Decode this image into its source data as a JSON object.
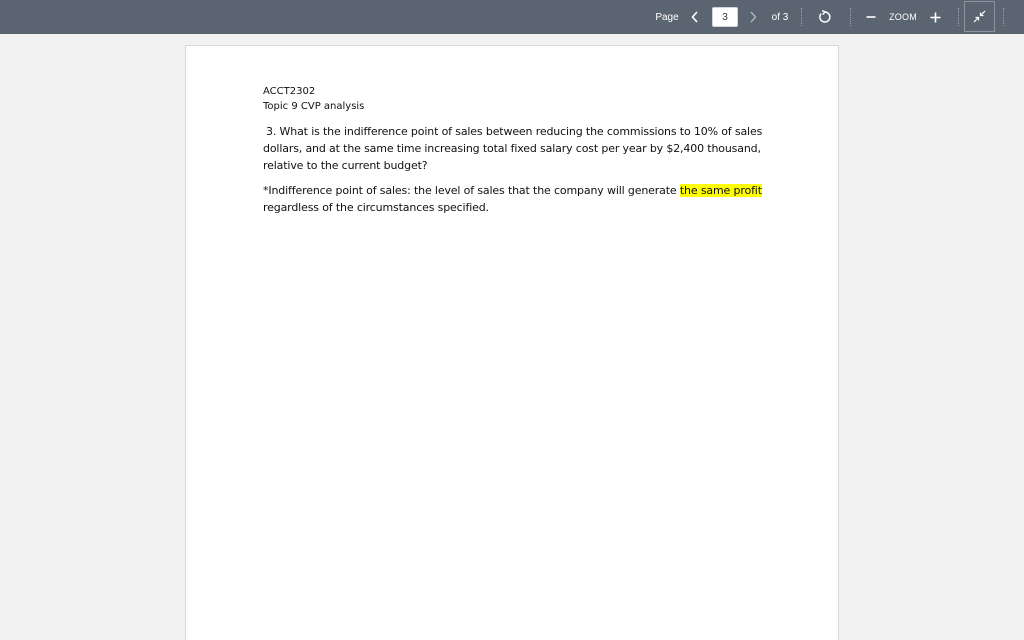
{
  "toolbar": {
    "page_label": "Page",
    "current_page": "3",
    "of_label": "of 3",
    "zoom_label": "ZOOM",
    "colors": {
      "background": "#5b6572",
      "text": "#ffffff"
    },
    "icons": {
      "prev": "chevron-left-icon",
      "next": "chevron-right-icon",
      "rotate": "rotate-icon",
      "zoom_out": "minus-icon",
      "zoom_in": "plus-icon",
      "fit": "collapse-arrows-icon"
    }
  },
  "document": {
    "course_code": "ACCT2302",
    "topic": "Topic 9 CVP analysis",
    "question_lines": [
      "3. What is the indifference point of sales between reducing the commissions to 10% of sales",
      "dollars, and at the same time increasing total fixed salary cost per year by $2,400 thousand,",
      "relative to the current budget?"
    ],
    "definition": {
      "line1_prefix": "*Indifference point of sales: the level of sales that the company will generate ",
      "line1_highlight": "the same profit",
      "line2": "regardless of the circumstances specified."
    },
    "highlight_color": "#ffff00"
  }
}
